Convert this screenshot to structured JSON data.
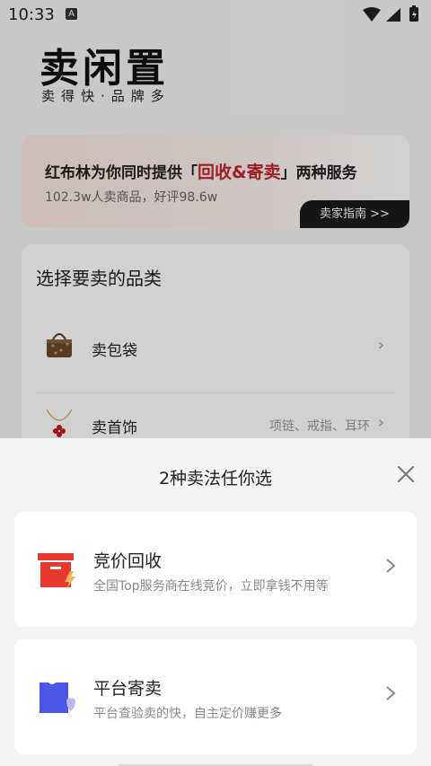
{
  "status_bar": {
    "time": "10:33",
    "badge": "A"
  },
  "header": {
    "title": "卖闲置",
    "subtitle": "卖得快·品牌多"
  },
  "promo": {
    "text_before": "红布林为你同时提供「",
    "highlight": "回收&寄卖",
    "text_after": "」两种服务",
    "stats": "102.3w人卖商品，好评98.6w",
    "guide_label": "卖家指南 >>"
  },
  "categories": {
    "heading": "选择要卖的品类",
    "items": [
      {
        "label": "卖包袋",
        "hint": "",
        "icon": "handbag-icon"
      },
      {
        "label": "卖首饰",
        "hint": "项链、戒指、耳环",
        "icon": "necklace-icon"
      }
    ]
  },
  "sheet": {
    "title": "2种卖法任你选",
    "options": [
      {
        "title": "竞价回收",
        "desc": "全国Top服务商在线竞价，立即拿钱不用等",
        "icon": "recycle-box-icon"
      },
      {
        "title": "平台寄卖",
        "desc": "平台查验卖的快，自主定价赚更多",
        "icon": "consign-bag-icon"
      }
    ]
  },
  "colors": {
    "accent_red": "#c0262c",
    "recycle_icon": "#e8392f",
    "consign_icon": "#4a57e6"
  }
}
